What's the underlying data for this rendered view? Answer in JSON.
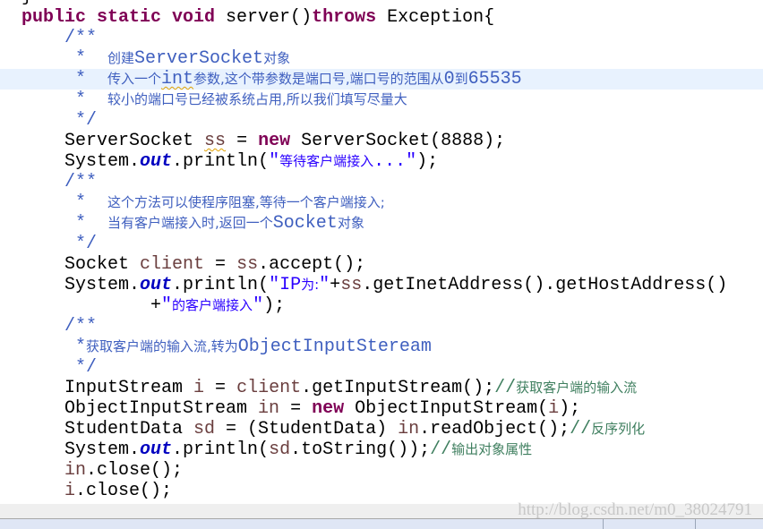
{
  "colors": {
    "keyword": "#7f0055",
    "javadoc": "#3f5fbf",
    "string": "#2a00ff",
    "line_comment": "#3f7f5f",
    "local_var": "#6a3e3e",
    "field": "#0000c0",
    "current_line": "#e8f2fe"
  },
  "highlighted_line": 4,
  "lines": [
    [
      [
        "p",
        "}"
      ]
    ],
    [
      [
        "k",
        "public static void"
      ],
      [
        "p",
        " server()"
      ],
      [
        "k",
        "throws"
      ],
      [
        "p",
        " Exception{"
      ]
    ],
    [
      [
        "j",
        "    /**"
      ]
    ],
    [
      [
        "j",
        "     *  "
      ],
      [
        "z",
        "创建"
      ],
      [
        "j",
        "ServerSocket"
      ],
      [
        "z",
        "对象"
      ]
    ],
    [
      [
        "j",
        "     *  "
      ],
      [
        "z",
        "传入一个"
      ],
      [
        "j w",
        "int"
      ],
      [
        "z",
        "参数,这个带参数是端口号,端口号的范围从"
      ],
      [
        "j",
        "0"
      ],
      [
        "z",
        "到"
      ],
      [
        "j",
        "65535"
      ]
    ],
    [
      [
        "j",
        "     *  "
      ],
      [
        "z",
        "较小的端口号已经被系统占用,所以我们填写尽量大"
      ]
    ],
    [
      [
        "j",
        "     */"
      ]
    ],
    [
      [
        "p",
        "    ServerSocket "
      ],
      [
        "v w",
        "ss"
      ],
      [
        "p",
        " = "
      ],
      [
        "k",
        "new"
      ],
      [
        "p",
        " ServerSocket(8888);"
      ]
    ],
    [
      [
        "p",
        "    System."
      ],
      [
        "f",
        "out"
      ],
      [
        "p",
        ".println("
      ],
      [
        "s",
        "\""
      ],
      [
        "sz",
        "等待客户端接入"
      ],
      [
        "s",
        "...\""
      ],
      [
        "p",
        ");"
      ]
    ],
    [
      [
        "j",
        "    /**"
      ]
    ],
    [
      [
        "j",
        "     *  "
      ],
      [
        "z",
        "这个方法可以使程序阻塞,等待一个客户端接入;"
      ]
    ],
    [
      [
        "j",
        "     *  "
      ],
      [
        "z",
        "当有客户端接入时,返回一个"
      ],
      [
        "j",
        "Socket"
      ],
      [
        "z",
        "对象"
      ]
    ],
    [
      [
        "j",
        "     */"
      ]
    ],
    [
      [
        "p",
        "    Socket "
      ],
      [
        "v",
        "client"
      ],
      [
        "p",
        " = "
      ],
      [
        "v",
        "ss"
      ],
      [
        "p",
        ".accept();"
      ]
    ],
    [
      [
        "p",
        "    System."
      ],
      [
        "f",
        "out"
      ],
      [
        "p",
        ".println("
      ],
      [
        "s",
        "\"IP"
      ],
      [
        "sz",
        "为:"
      ],
      [
        "s",
        "\""
      ],
      [
        "p",
        "+"
      ],
      [
        "v",
        "ss"
      ],
      [
        "p",
        ".getInetAddress().getHostAddress()"
      ]
    ],
    [
      [
        "p",
        "            +"
      ],
      [
        "s",
        "\""
      ],
      [
        "sz",
        "的客户端接入"
      ],
      [
        "s",
        "\""
      ],
      [
        "p",
        ");"
      ]
    ],
    [
      [
        "j",
        "    /**"
      ]
    ],
    [
      [
        "j",
        "     *"
      ],
      [
        "z",
        "获取客户端的输入流,转为"
      ],
      [
        "j",
        "ObjectInputSteream"
      ]
    ],
    [
      [
        "j",
        "     */"
      ]
    ],
    [
      [
        "p",
        "    InputStream "
      ],
      [
        "v",
        "i"
      ],
      [
        "p",
        " = "
      ],
      [
        "v",
        "client"
      ],
      [
        "p",
        ".getInputStream();"
      ],
      [
        "g",
        "//"
      ],
      [
        "gz",
        "获取客户端的输入流"
      ]
    ],
    [
      [
        "p",
        "    ObjectInputStream "
      ],
      [
        "v",
        "in"
      ],
      [
        "p",
        " = "
      ],
      [
        "k",
        "new"
      ],
      [
        "p",
        " ObjectInputStream("
      ],
      [
        "v",
        "i"
      ],
      [
        "p",
        ");"
      ]
    ],
    [
      [
        "p",
        "    StudentData "
      ],
      [
        "v",
        "sd"
      ],
      [
        "p",
        " = (StudentData) "
      ],
      [
        "v",
        "in"
      ],
      [
        "p",
        ".readObject();"
      ],
      [
        "g",
        "//"
      ],
      [
        "gz",
        "反序列化"
      ]
    ],
    [
      [
        "p",
        "    System."
      ],
      [
        "f",
        "out"
      ],
      [
        "p",
        ".println("
      ],
      [
        "v",
        "sd"
      ],
      [
        "p",
        ".toString());"
      ],
      [
        "g",
        "//"
      ],
      [
        "gz",
        "输出对象属性"
      ]
    ],
    [
      [
        "p",
        "    "
      ],
      [
        "v",
        "in"
      ],
      [
        "p",
        ".close();"
      ]
    ],
    [
      [
        "p",
        "    "
      ],
      [
        "v",
        "i"
      ],
      [
        "p",
        ".close();"
      ]
    ]
  ],
  "watermark": "http://blog.csdn.net/m0_38024791"
}
